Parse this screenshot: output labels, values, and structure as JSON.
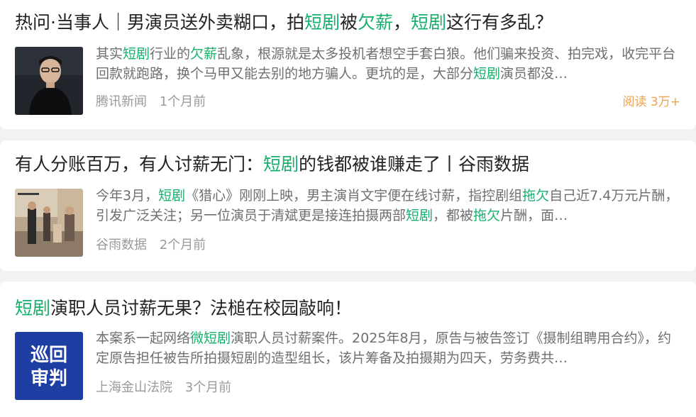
{
  "articles": [
    {
      "title_parts": [
        {
          "text": "热问·当事人｜男演员送外卖糊口，拍",
          "hl": false
        },
        {
          "text": "短剧",
          "hl": true
        },
        {
          "text": "被",
          "hl": false
        },
        {
          "text": "欠薪",
          "hl": true
        },
        {
          "text": "，",
          "hl": false
        },
        {
          "text": "短剧",
          "hl": true
        },
        {
          "text": "这行有多乱？",
          "hl": false
        }
      ],
      "summary_parts": [
        {
          "text": "其实",
          "hl": false
        },
        {
          "text": "短剧",
          "hl": true
        },
        {
          "text": "行业的",
          "hl": false
        },
        {
          "text": "欠薪",
          "hl": true
        },
        {
          "text": "乱象，根源就是太多投机者想空手套白狼。他们骗来投资、拍完戏，收完平台回款就跑路，换个马甲又能去别的地方骗人。更坑的是，大部分",
          "hl": false
        },
        {
          "text": "短剧",
          "hl": true
        },
        {
          "text": "演员都没…",
          "hl": false
        }
      ],
      "source": "腾讯新闻",
      "time": "1个月前",
      "reads": "阅读 3万+",
      "thumb": "man-portrait"
    },
    {
      "title_parts": [
        {
          "text": "有人分账百万，有人讨薪无门：",
          "hl": false
        },
        {
          "text": "短剧",
          "hl": true
        },
        {
          "text": "的钱都被谁赚走了丨谷雨数据",
          "hl": false
        }
      ],
      "summary_parts": [
        {
          "text": "今年3月，",
          "hl": false
        },
        {
          "text": "短剧",
          "hl": true
        },
        {
          "text": "《猎心》刚刚上映，男主演肖文宇便在线讨薪，指控剧组",
          "hl": false
        },
        {
          "text": "拖欠",
          "hl": true
        },
        {
          "text": "自己近7.4万元片酬，引发广泛关注；另一位演员于清斌更是接连拍摄两部",
          "hl": false
        },
        {
          "text": "短剧",
          "hl": true
        },
        {
          "text": "，都被",
          "hl": false
        },
        {
          "text": "拖欠",
          "hl": true
        },
        {
          "text": "片酬，面…",
          "hl": false
        }
      ],
      "source": "谷雨数据",
      "time": "2个月前",
      "reads": "",
      "thumb": "film-set"
    },
    {
      "title_parts": [
        {
          "text": "短剧",
          "hl": true
        },
        {
          "text": "演职人员讨薪无果？法槌在校园敲响！",
          "hl": false
        }
      ],
      "summary_parts": [
        {
          "text": "本案系一起网络",
          "hl": false
        },
        {
          "text": "微短剧",
          "hl": true
        },
        {
          "text": "演职人员讨薪案件。2025年8月，原告与被告签订《摄制组聘用合约》，约定原告担任被告所拍摄短剧的造型组长，该片筹备及拍摄期为四天，劳务费共…",
          "hl": false
        }
      ],
      "source": "上海金山法院",
      "time": "3个月前",
      "reads": "",
      "thumb": "court-logo",
      "thumb_text": [
        "巡回",
        "审判"
      ]
    }
  ],
  "colors": {
    "highlight": "#15b06b",
    "title": "#222222",
    "summary": "#6f6f6f",
    "meta": "#9a9a9a",
    "reads": "#f0a24a",
    "court_blue": "#1f3ea3"
  }
}
